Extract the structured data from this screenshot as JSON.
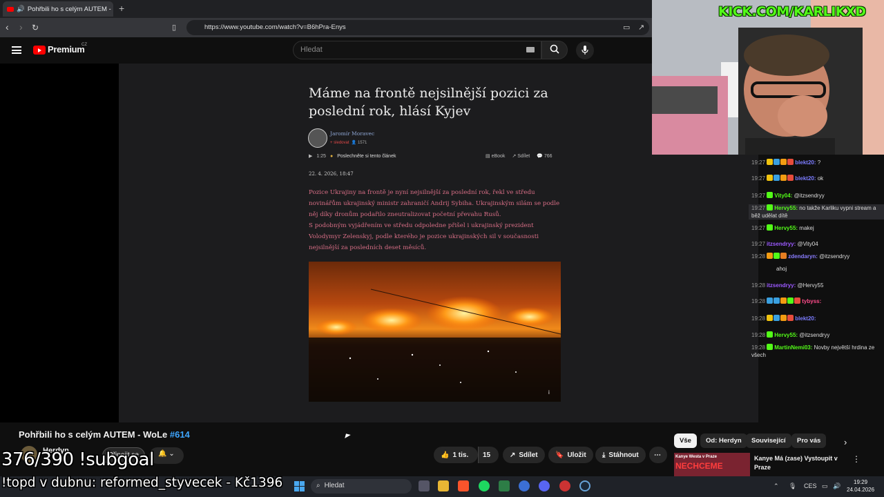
{
  "browser": {
    "tab_title": "Pohřbili ho s celým AUTEM -",
    "tab_close": "✕",
    "new_tab": "+",
    "url": "https://www.youtube.com/watch?v=B6hPra-Enys"
  },
  "youtube": {
    "logo_text": "Premium",
    "logo_country": "CZ",
    "search_placeholder": "Hledat"
  },
  "article": {
    "title": "Máme na frontě nejsilnější pozici za poslední rok, hlásí Kyjev",
    "author": "Jaromír Moravec",
    "follow": "+ sledovat",
    "followers": "1571",
    "audio_time": "1:25",
    "listen_label": "Poslechněte si tento článek",
    "ebook": "eBook",
    "share": "Sdílet",
    "comments": "766",
    "date": "22. 4. 2026, 18:47",
    "paragraphs": [
      "Pozice Ukrajiny na frontě je nyní nejsilnější za poslední rok, řekl ve středu novinářům ukrajinský ministr zahraničí Andrij Sybiha. Ukrajinským silám se podle něj díky dronům podařilo zneutralizovat početní převahu Rusů.",
      "S podobným vyjádřením ve středu odpoledne přišel i ukrajinský prezident Volodymyr Zelenskyj, podle kterého je pozice ukrajinských sil v současnosti nejsilnější za posledních deset měsíců."
    ],
    "image_info": "i"
  },
  "stream": {
    "kick": "KICK.COM/KARLIKXD",
    "subgoal": "376/390 !subgoal",
    "ticker": "!topd v dubnu: reformed_styvecek - Kč1396"
  },
  "chat": [
    {
      "time": "19:27",
      "user": "blekt20:",
      "color": "#7c7cff",
      "text": " ?",
      "badges": [
        "#f1c40f",
        "#3aa0e0",
        "#f39c12",
        "#e74c3c"
      ],
      "hl": false
    },
    {
      "time": "19:27",
      "user": "blekt20:",
      "color": "#7c7cff",
      "text": " ok",
      "badges": [
        "#f1c40f",
        "#3aa0e0",
        "#f39c12",
        "#e74c3c"
      ],
      "hl": false
    },
    {
      "time": "19:27",
      "user": "Vity04:",
      "color": "#53fc18",
      "text": " @itzsendryy",
      "badges": [
        "#53fc18"
      ],
      "hl": false
    },
    {
      "time": "19:27",
      "user": "Hervy55:",
      "color": "#53fc18",
      "text": " no takže Karliku vypni stream a běž udělat dítě",
      "badges": [
        "#53fc18"
      ],
      "hl": true
    },
    {
      "time": "19:27",
      "user": "Hervy55:",
      "color": "#53fc18",
      "text": " makej",
      "badges": [
        "#53fc18"
      ],
      "hl": false
    },
    {
      "time": "19:27",
      "user": "itzsendryy:",
      "color": "#9b59ff",
      "text": " @Vity04",
      "badges": [],
      "hl": false
    },
    {
      "time": "19:28",
      "user": "zdendaryn:",
      "color": "#8a7dff",
      "text": " @itzsendryy",
      "badges": [
        "#f39c12",
        "#53fc18",
        "#e67e22"
      ],
      "hl": false
    },
    {
      "time": "",
      "user": "",
      "color": "#ddd",
      "text": "ahoj",
      "badges": [],
      "hl": false
    },
    {
      "time": "19:28",
      "user": "itzsendryy:",
      "color": "#9b59ff",
      "text": " @Hervy55",
      "badges": [],
      "hl": false
    },
    {
      "time": "19:28",
      "user": "tybyss:",
      "color": "#ff4c8b",
      "text": "",
      "badges": [
        "#3aa0e0",
        "#3aa0e0",
        "#f39c12",
        "#53fc18",
        "#e74c3c"
      ],
      "hl": false
    },
    {
      "time": "19:28",
      "user": "blekt20:",
      "color": "#7c7cff",
      "text": "",
      "badges": [
        "#f1c40f",
        "#3aa0e0",
        "#f39c12",
        "#e74c3c"
      ],
      "hl": false
    },
    {
      "time": "19:28",
      "user": "Hervy55:",
      "color": "#53fc18",
      "text": " @itzsendryy",
      "badges": [
        "#53fc18"
      ],
      "hl": false
    },
    {
      "time": "19:28",
      "user": "MartinNemi03:",
      "color": "#53fc18",
      "text": " Novby největší hrdina ze všech",
      "badges": [
        "#53fc18"
      ],
      "hl": false
    }
  ],
  "video": {
    "title": "Pohřbili ho s celým AUTEM - WoLe",
    "number": "#614",
    "channel": "Herdyn",
    "join": "Připojit se",
    "likes": "1 tis.",
    "dislikes": "15",
    "share": "Sdílet",
    "save": "Uložit",
    "download": "Stáhnout",
    "more": "⋯"
  },
  "chips": [
    "Vše",
    "Od: Herdyn",
    "Související",
    "Pro vás"
  ],
  "recommended": {
    "thumb_top": "Kanye Westa v Praze",
    "thumb_big": "NECHCEME",
    "title": "Kanye Má (zase) Vystoupit v Praze",
    "more": "⋮"
  },
  "taskbar": {
    "search": "Hledat",
    "lang": "CES",
    "time": "19:29",
    "date": "24.04.2026"
  }
}
